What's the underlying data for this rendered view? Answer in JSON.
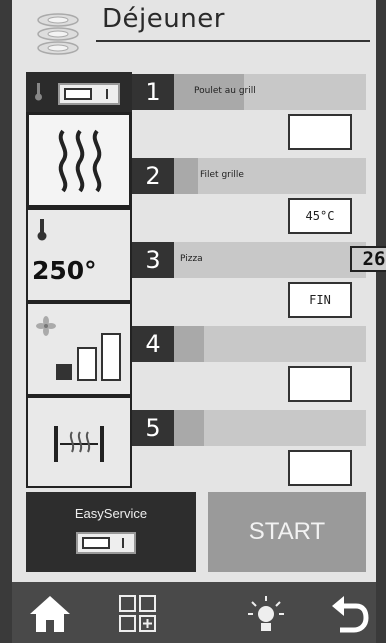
{
  "header": {
    "title": "Déjeuner",
    "icon": "stacked-plates-icon"
  },
  "left_panel": {
    "mode_toggle": {
      "state": "off",
      "icon": "thermometer-small-icon"
    },
    "heat_mode": {
      "icon": "heat-waves-icon",
      "selected": true
    },
    "temperature": {
      "icon": "thermometer-icon",
      "value": "250°"
    },
    "fan": {
      "icon": "fan-speed-icon",
      "level": 2
    },
    "steam": {
      "icon": "steam-door-icon"
    }
  },
  "rows": [
    {
      "number": "1",
      "name": "Poulet au grill",
      "value": "",
      "timer": "",
      "fill": 0.22
    },
    {
      "number": "2",
      "name": "Filet grille",
      "value": "45°C",
      "timer": "",
      "fill": 0.12
    },
    {
      "number": "3",
      "name": "Pizza",
      "value": "FIN",
      "timer": "26",
      "fill": 0.0
    },
    {
      "number": "4",
      "name": "",
      "value": "",
      "timer": "",
      "fill": 0.2
    },
    {
      "number": "5",
      "name": "",
      "value": "",
      "timer": "",
      "fill": 0.2
    }
  ],
  "buttons": {
    "easyservice_label": "EasyService",
    "easyservice_toggle": "off",
    "start_label": "START"
  },
  "navbar": {
    "items": [
      "home-icon",
      "grid-add-icon",
      "light-bulb-icon",
      "back-arrow-icon"
    ]
  },
  "colors": {
    "dark": "#2d2d2d",
    "start_button": "#9a9a9a",
    "background": "#e4e4e4"
  }
}
